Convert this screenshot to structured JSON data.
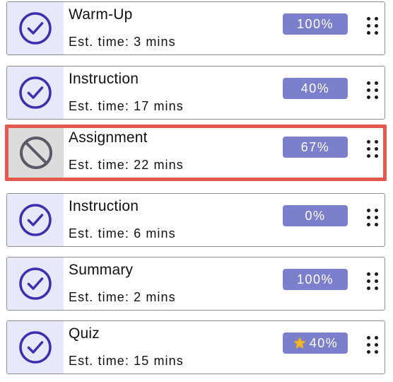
{
  "items": [
    {
      "title": "Warm-Up",
      "est_time": "Est. time: 3 mins",
      "progress_label": "100%",
      "status_icon": "check-circle-icon",
      "starred": false,
      "selected": false
    },
    {
      "title": "Instruction",
      "est_time": "Est. time: 17 mins",
      "progress_label": "40%",
      "status_icon": "check-circle-icon",
      "starred": false,
      "selected": false
    },
    {
      "title": "Assignment",
      "est_time": "Est. time: 22 mins",
      "progress_label": "67%",
      "status_icon": "blocked-circle-icon",
      "starred": false,
      "selected": true
    },
    {
      "title": "Instruction",
      "est_time": "Est. time: 6 mins",
      "progress_label": "0%",
      "status_icon": "check-circle-icon",
      "starred": false,
      "selected": false
    },
    {
      "title": "Summary",
      "est_time": "Est. time: 2 mins",
      "progress_label": "100%",
      "status_icon": "check-circle-icon",
      "starred": false,
      "selected": false
    },
    {
      "title": "Quiz",
      "est_time": "Est. time: 15 mins",
      "progress_label": "40%",
      "status_icon": "check-circle-icon",
      "starred": true,
      "selected": false
    }
  ],
  "colors": {
    "accent": "#3f2fb0",
    "icon_cell_bg": "#e8e8fb",
    "blocked_icon": "#5a5a66",
    "blocked_cell_bg": "#dcdcdc",
    "badge_bg": "#7c7fcb",
    "selected_border": "#e45a4f",
    "star": "#f2b829"
  }
}
